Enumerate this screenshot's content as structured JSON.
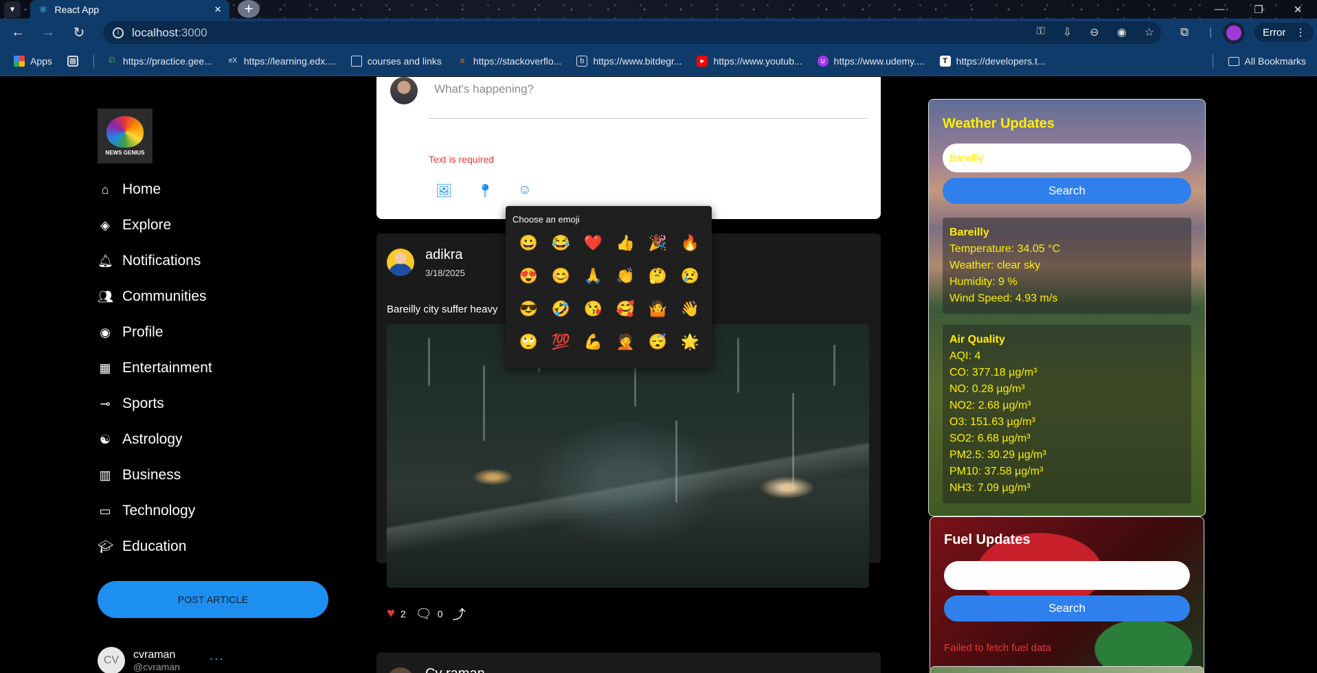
{
  "browser": {
    "tab_title": "React App",
    "url_host": "localhost",
    "url_port": ":3000",
    "error_label": "Error",
    "bookmarks": [
      {
        "label": "Apps",
        "icon": "apps-grid-icon"
      },
      {
        "label": "https://practice.gee...",
        "icon": "geeksforgeeks-icon"
      },
      {
        "label": "https://learning.edx....",
        "icon": "edx-icon"
      },
      {
        "label": "courses and links",
        "icon": "folder-icon"
      },
      {
        "label": "https://stackoverflo...",
        "icon": "stackoverflow-icon"
      },
      {
        "label": "https://www.bitdegr...",
        "icon": "bitdegree-icon"
      },
      {
        "label": "https://www.youtub...",
        "icon": "youtube-icon"
      },
      {
        "label": "https://www.udemy....",
        "icon": "udemy-icon"
      },
      {
        "label": "https://developers.t...",
        "icon": "tiktok-dev-icon"
      }
    ],
    "all_bookmarks": "All Bookmarks"
  },
  "sidebar": {
    "logo_text": "NEWS GENIUS",
    "items": [
      {
        "label": "Home",
        "icon": "home-icon"
      },
      {
        "label": "Explore",
        "icon": "compass-icon"
      },
      {
        "label": "Notifications",
        "icon": "bell-icon"
      },
      {
        "label": "Communities",
        "icon": "people-icon"
      },
      {
        "label": "Profile",
        "icon": "account-circle-icon"
      },
      {
        "label": "Entertainment",
        "icon": "film-icon"
      },
      {
        "label": "Sports",
        "icon": "whistle-icon"
      },
      {
        "label": "Astrology",
        "icon": "psychology-icon"
      },
      {
        "label": "Business",
        "icon": "building-icon"
      },
      {
        "label": "Technology",
        "icon": "laptop-icon"
      },
      {
        "label": "Education",
        "icon": "school-icon"
      }
    ],
    "post_button": "POST ARTICLE",
    "user": {
      "initials": "CV",
      "name": "cvraman",
      "handle": "@cvraman"
    }
  },
  "composer": {
    "placeholder": "What's happening?",
    "error": "Text is required"
  },
  "emoji_picker": {
    "title": "Choose an emoji",
    "emojis": [
      "😀",
      "😂",
      "❤️",
      "👍",
      "🎉",
      "🔥",
      "😍",
      "😊",
      "🙏",
      "👏",
      "🤔",
      "😢",
      "😎",
      "🤣",
      "😘",
      "🥰",
      "🤷",
      "👋",
      "🙄",
      "💯",
      "💪",
      "🤦",
      "😴",
      "🌟"
    ]
  },
  "post": {
    "author": "adikra",
    "date": "3/18/2025",
    "text": "Bareilly city suffer heavy",
    "likes": "2",
    "comments": "0"
  },
  "post2": {
    "author": "Cv raman"
  },
  "weather": {
    "title": "Weather Updates",
    "city_value": "Bareilly",
    "search_label": "Search",
    "current": {
      "city": "Bareilly",
      "temperature": "Temperature: 34.05 °C",
      "weather": "Weather: clear sky",
      "humidity": "Humidity: 9 %",
      "wind": "Wind Speed: 4.93 m/s"
    },
    "air": {
      "title": "Air Quality",
      "lines": [
        "AQI: 4",
        "CO: 377.18 µg/m³",
        "NO: 0.28 µg/m³",
        "NO2: 2.68 µg/m³",
        "O3: 151.63 µg/m³",
        "SO2: 6.68 µg/m³",
        "PM2.5: 30.29 µg/m³",
        "PM10: 37.58 µg/m³",
        "NH3: 7.09 µg/m³"
      ]
    }
  },
  "fuel": {
    "title": "Fuel Updates",
    "input_value": "",
    "search_label": "Search",
    "error": "Failed to fetch fuel data"
  }
}
